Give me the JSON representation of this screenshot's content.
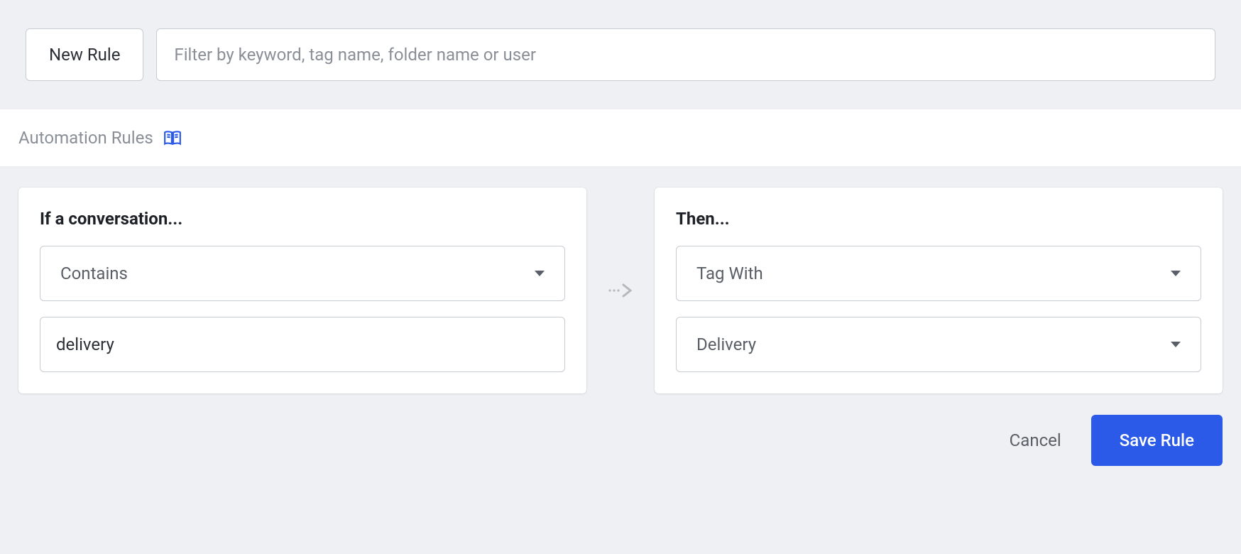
{
  "toolbar": {
    "new_rule_label": "New Rule",
    "filter_placeholder": "Filter by keyword, tag name, folder name or user"
  },
  "section": {
    "title": "Automation Rules"
  },
  "condition": {
    "title": "If a conversation...",
    "operator": "Contains",
    "value": "delivery"
  },
  "action": {
    "title": "Then...",
    "operator": "Tag With",
    "value": "Delivery"
  },
  "footer": {
    "cancel_label": "Cancel",
    "save_label": "Save Rule"
  }
}
